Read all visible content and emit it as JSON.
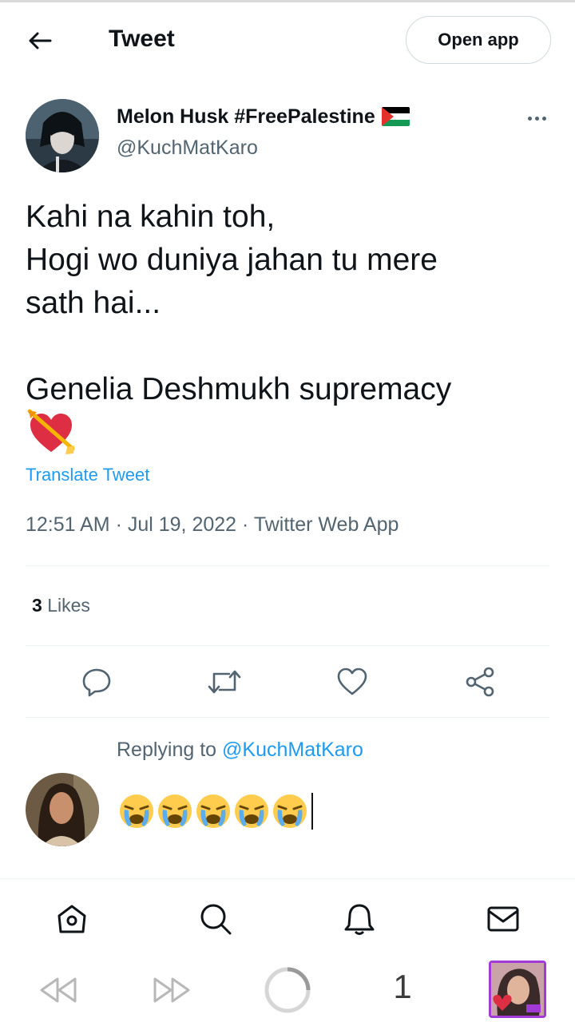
{
  "header": {
    "title": "Tweet",
    "open_app_label": "Open app"
  },
  "author": {
    "name": "Melon Husk #FreePalestine",
    "handle": "@KuchMatKaro",
    "flag_icon": "palestine-flag-icon"
  },
  "tweet": {
    "text": "Kahi na kahin toh,\nHogi wo duniya jahan tu mere\nsath hai...\n\nGenelia Deshmukh supremacy",
    "emoji": "heart-with-arrow-emoji",
    "translate_label": "Translate Tweet",
    "meta": "12:51 AM · Jul 19, 2022 · Twitter Web App"
  },
  "stats": {
    "likes_count": "3",
    "likes_label": "Likes"
  },
  "actions": [
    "reply-icon",
    "retweet-icon",
    "like-icon",
    "share-icon"
  ],
  "reply": {
    "replying_prefix": "Replying to",
    "replying_mention": "@KuchMatKaro",
    "draft_emojis": [
      "loudly-crying-face-emoji",
      "loudly-crying-face-emoji",
      "loudly-crying-face-emoji",
      "loudly-crying-face-emoji",
      "loudly-crying-face-emoji"
    ]
  },
  "bottom_nav": [
    "home-icon",
    "search-icon",
    "notifications-icon",
    "messages-icon"
  ],
  "browser_bar": {
    "tab_count": "1"
  },
  "colors": {
    "accent": "#1d9bf0",
    "secondary_text": "#536471",
    "tab_border": "#a23bd6"
  }
}
